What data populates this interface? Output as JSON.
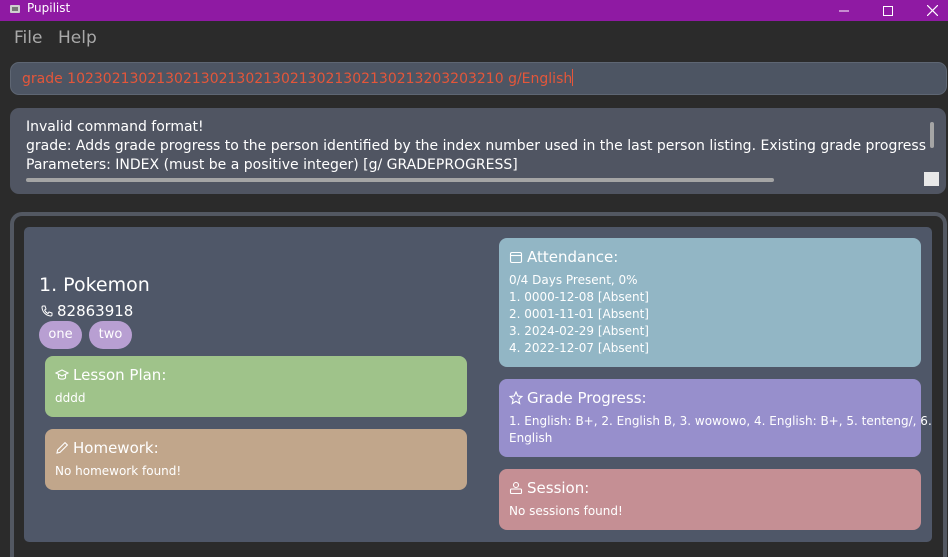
{
  "window": {
    "title": "Pupilist"
  },
  "menu": {
    "items": [
      "File",
      "Help"
    ]
  },
  "command": {
    "value": "grade 1023021302130213021302130213021302130213203203210 g/English"
  },
  "result": {
    "lines": [
      "Invalid command format!",
      "grade: Adds grade progress to the person identified by the index number used in the last person listing. Existing grade progress will be overwritten by the input.",
      "Parameters: INDEX (must be a positive integer) [g/ GRADEPROGRESS]"
    ]
  },
  "person": {
    "index_name": "1.  Pokemon",
    "phone": "82863918",
    "tags": [
      "one",
      "two"
    ],
    "lesson_plan": {
      "title": "Lesson Plan:",
      "value": "dddd"
    },
    "homework": {
      "title": "Homework:",
      "value": "No homework found!"
    },
    "attendance": {
      "title": "Attendance:",
      "summary": "0/4 Days Present, 0%",
      "entries": [
        "1. 0000-12-08 [Absent]",
        "2. 0001-11-01 [Absent]",
        "3. 2024-02-29 [Absent]",
        "4. 2022-12-07 [Absent]"
      ]
    },
    "grade_progress": {
      "title": "Grade Progress:",
      "line1": "1. English: B+, 2. English B, 3. wowowo, 4. English: B+, 5. tenteng/, 6.",
      "line2": "English"
    },
    "session": {
      "title": "Session:",
      "value": "No sessions found!"
    }
  },
  "colors": {
    "titlebar": "#8f1aa3",
    "command_text": "#e4563a",
    "lesson": "#9fc38a",
    "homework": "#c1a68b",
    "attendance": "#92b6c5",
    "grade": "#978fcc",
    "session": "#c58f94",
    "tag": "#b89fd2"
  },
  "icons": [
    "app-icon",
    "minimize-icon",
    "maximize-icon",
    "close-icon",
    "phone-icon",
    "graduation-cap-icon",
    "pencil-icon",
    "calendar-icon",
    "star-icon",
    "session-icon"
  ]
}
